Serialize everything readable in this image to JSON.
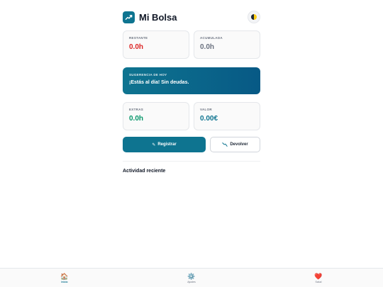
{
  "app": {
    "title": "Mi Bolsa"
  },
  "stats": {
    "restante": {
      "label": "RESTANTE",
      "value": "0.0h",
      "color": "#dc2626"
    },
    "acumulada": {
      "label": "ACUMULADA",
      "value": "0.0h",
      "color": "#6b7280"
    },
    "extras": {
      "label": "EXTRAS",
      "value": "0.0h",
      "color": "#059669"
    },
    "valor": {
      "label": "VALOR",
      "value": "0.00€",
      "color": "#0e7490"
    }
  },
  "suggestion": {
    "label": "SUGERENCIA DE HOY",
    "text": "¡Estás al día! Sin deudas."
  },
  "actions": {
    "register_label": "Registrar",
    "return_label": "Devolver"
  },
  "recent": {
    "title": "Actividad reciente"
  },
  "nav": {
    "items": [
      {
        "label": "Inicio",
        "icon": "home-icon",
        "active": true
      },
      {
        "label": "Ajustes",
        "icon": "gear-icon",
        "active": false
      },
      {
        "label": "Salud",
        "icon": "heart-icon",
        "active": false
      }
    ]
  },
  "colors": {
    "accent": "#0e7490"
  }
}
